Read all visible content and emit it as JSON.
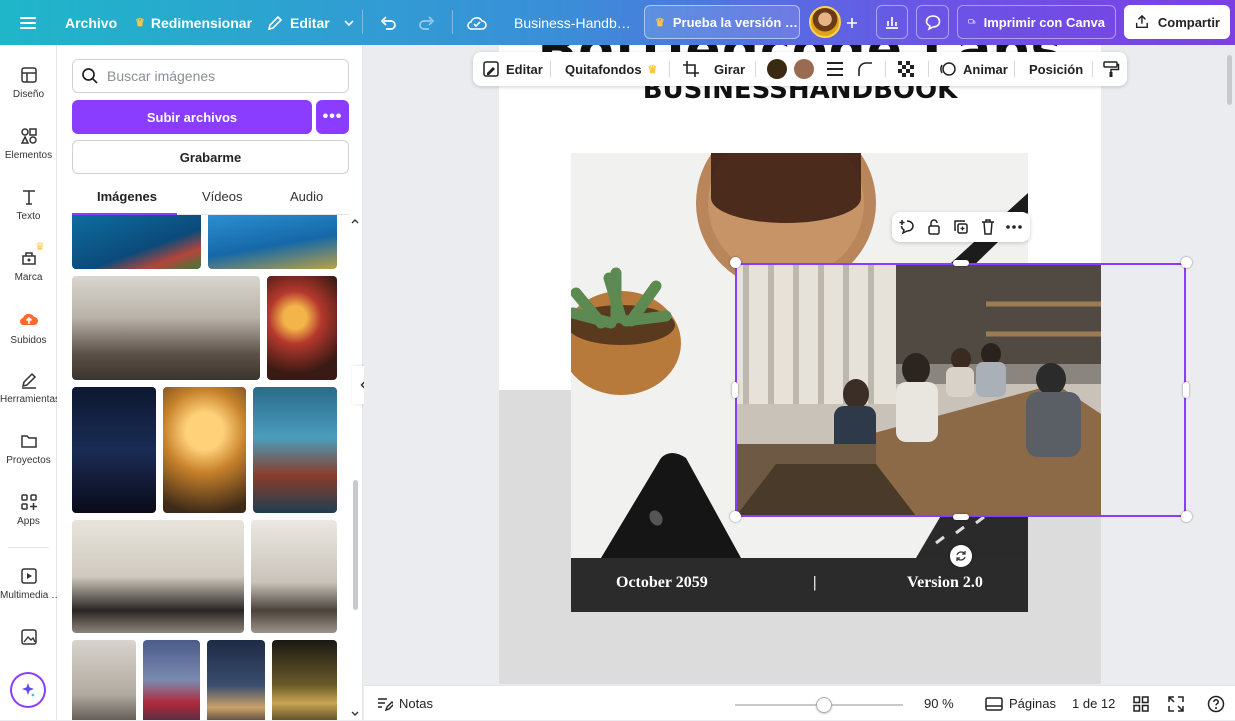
{
  "topbar": {
    "file_label": "Archivo",
    "resize_label": "Redimensionar",
    "edit_label": "Editar",
    "doc_title": "Business-Handb…",
    "trial_label": "Prueba la versión …",
    "print_label": "Imprimir con Canva",
    "share_label": "Compartir"
  },
  "rail": {
    "items": [
      {
        "label": "Diseño",
        "icon": "layout-icon"
      },
      {
        "label": "Elementos",
        "icon": "shapes-icon"
      },
      {
        "label": "Texto",
        "icon": "text-icon"
      },
      {
        "label": "Marca",
        "icon": "brand-icon"
      },
      {
        "label": "Subidos",
        "icon": "cloud-upload-icon"
      },
      {
        "label": "Herramientas",
        "icon": "pen-icon"
      },
      {
        "label": "Proyectos",
        "icon": "folder-icon"
      },
      {
        "label": "Apps",
        "icon": "apps-icon"
      },
      {
        "label": "Multimedia …",
        "icon": "media-icon"
      },
      {
        "label": "",
        "icon": "image-icon"
      }
    ]
  },
  "panel": {
    "search_placeholder": "Buscar imágenes",
    "upload_label": "Subir archivos",
    "record_label": "Grabarme",
    "tabs": [
      "Imágenes",
      "Vídeos",
      "Audio"
    ]
  },
  "context_toolbar": {
    "edit": "Editar",
    "bg_remover": "Quitafondos",
    "flip": "Girar",
    "animate": "Animar",
    "position": "Posición",
    "colors": [
      "#3b2a12",
      "#9b6a52"
    ]
  },
  "page": {
    "title_top": "Bottledcode Labs",
    "subtitle": "BUSINESSHANDBOOK",
    "date": "October 2059",
    "separator": "|",
    "version": "Version 2.0"
  },
  "bottombar": {
    "notes": "Notas",
    "zoom": "90 %",
    "pages_label": "Páginas",
    "page_counter": "1 de 12",
    "zoom_fraction": 0.53
  },
  "colors": {
    "accent": "#8b3dff"
  }
}
